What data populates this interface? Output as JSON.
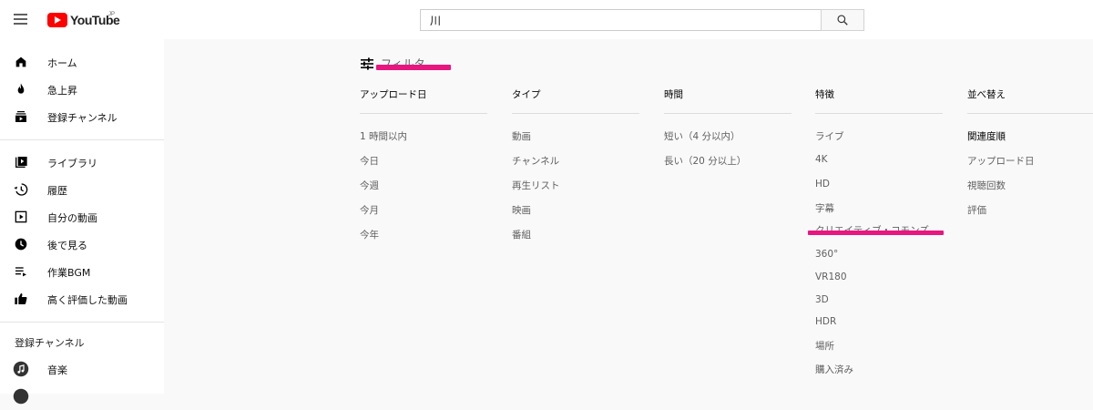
{
  "header": {
    "logo_text": "YouTube",
    "logo_region": "JP",
    "search_value": "川"
  },
  "sidebar": {
    "primary": [
      {
        "label": "ホーム",
        "icon": "home-icon"
      },
      {
        "label": "急上昇",
        "icon": "trending-icon"
      },
      {
        "label": "登録チャンネル",
        "icon": "subscriptions-icon"
      }
    ],
    "library": [
      {
        "label": "ライブラリ",
        "icon": "library-icon"
      },
      {
        "label": "履歴",
        "icon": "history-icon"
      },
      {
        "label": "自分の動画",
        "icon": "your-videos-icon"
      },
      {
        "label": "後で見る",
        "icon": "watch-later-icon"
      },
      {
        "label": "作業BGM",
        "icon": "playlist-icon"
      },
      {
        "label": "高く評価した動画",
        "icon": "liked-icon"
      }
    ],
    "subscriptions_title": "登録チャンネル",
    "subscriptions": [
      {
        "label": "音楽",
        "icon": "music-icon"
      }
    ]
  },
  "filter": {
    "label": "フィルタ",
    "highlight_color": "#e8167f",
    "columns": [
      {
        "title": "アップロード日",
        "items": [
          "1 時間以内",
          "今日",
          "今週",
          "今月",
          "今年"
        ]
      },
      {
        "title": "タイプ",
        "items": [
          "動画",
          "チャンネル",
          "再生リスト",
          "映画",
          "番組"
        ]
      },
      {
        "title": "時間",
        "items": [
          "短い（4 分以内）",
          "長い（20 分以上）"
        ]
      },
      {
        "title": "特徴",
        "items": [
          "ライブ",
          "4K",
          "HD",
          "字幕",
          "クリエイティブ・コモンズ",
          "360°",
          "VR180",
          "3D",
          "HDR",
          "場所",
          "購入済み"
        ]
      },
      {
        "title": "並べ替え",
        "items": [
          "関連度順",
          "アップロード日",
          "視聴回数",
          "評価"
        ],
        "selected_index": 0
      }
    ]
  }
}
